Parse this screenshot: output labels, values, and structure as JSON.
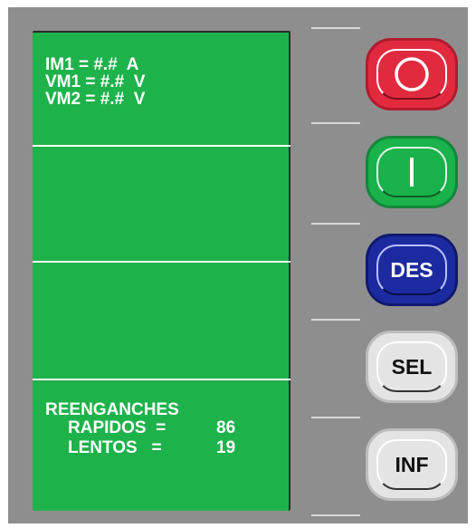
{
  "display": {
    "measurements": {
      "line1": "IM1 = #.#  A",
      "line2": "VM1 = #.#  V",
      "line3": "VM2 = #.#  V"
    },
    "reclosers": {
      "title": "REENGANCHES",
      "rapid_label": "RAPIDOS  =",
      "rapid_value": "86",
      "slow_label": "LENTOS   =",
      "slow_value": "19"
    }
  },
  "buttons": {
    "open": {
      "icon": "circle-o-icon",
      "color": "#e22a3f"
    },
    "close": {
      "icon": "vertical-bar-icon",
      "color": "#1ab24a"
    },
    "des": {
      "label": "DES",
      "color": "#1c2aa0"
    },
    "sel": {
      "label": "SEL",
      "color": "#e4e4e4"
    },
    "inf": {
      "label": "INF",
      "color": "#e4e4e4"
    }
  },
  "colors": {
    "panel": "#8e8e8e",
    "screen": "#1eb24b"
  }
}
